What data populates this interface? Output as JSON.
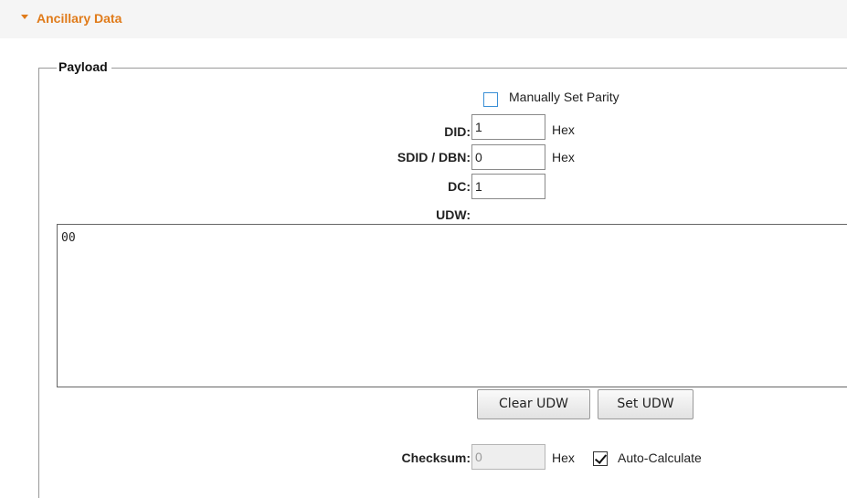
{
  "section": {
    "title": "Ancillary Data"
  },
  "payload": {
    "legend": "Payload",
    "manual_parity_label": "Manually Set Parity",
    "manual_parity_checked": false,
    "did": {
      "label": "DID:",
      "value": "1",
      "unit": "Hex"
    },
    "sdid": {
      "label": "SDID / DBN:",
      "value": "0",
      "unit": "Hex"
    },
    "dc": {
      "label": "DC:",
      "value": "1"
    },
    "udw": {
      "label": "UDW:",
      "value": "00"
    },
    "clear_button": "Clear UDW",
    "set_button": "Set UDW",
    "checksum": {
      "label": "Checksum:",
      "value": "0",
      "unit": "Hex"
    },
    "auto_calc_label": "Auto-Calculate",
    "auto_calc_checked": true
  },
  "colors": {
    "accent": "#e07b1a",
    "checkbox_border": "#3a8fd6"
  },
  "icons": {
    "section_toggle": "caret-down-icon",
    "check": "checkmark-icon"
  }
}
